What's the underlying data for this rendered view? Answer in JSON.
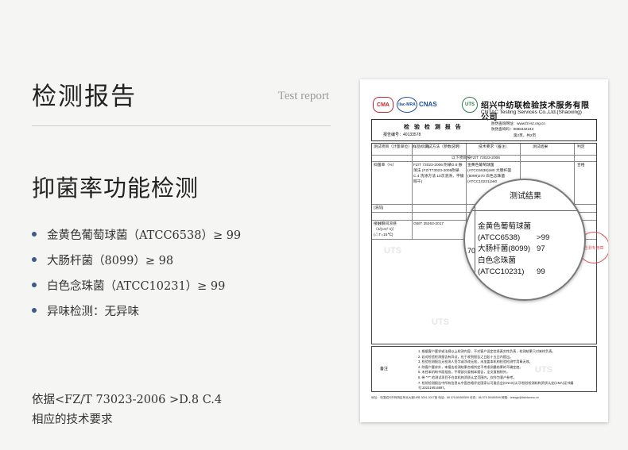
{
  "header": {
    "title": "检测报告",
    "subtitle_en": "Test report"
  },
  "section": {
    "title": "抑菌率功能检测"
  },
  "results": [
    "金黄色葡萄球菌（ATCC6538）≥ 99",
    "大肠杆菌（8099）≥ 98",
    "白色念珠菌（ATCC10231）≥ 99",
    "异味检测：无异味"
  ],
  "basis": {
    "line1": "依据<FZ/T 73023-2006 >D.8 C.4",
    "line2": "相应的技术要求"
  },
  "report": {
    "company_cn": "绍兴中纺联检验技术服务有限公司",
    "company_en": "CNTAC Testing Services Co.,Ltd.(Shaoxing)",
    "doc_title": "检 验 检 测 报 告",
    "report_no_label": "报告编号：",
    "report_no": "40133578",
    "query_site": "防伪查询网址：www.fzi-sz.org.cn",
    "query_code": "防伪查询码：0088432243",
    "page": "第2页，共2页",
    "col_item": "测试项目（计量单位）[样品标识]",
    "col_method": "测试方法（参数说明）",
    "col_req": "技术要求（备注）",
    "col_result": "测试结果",
    "col_judge": "判定",
    "below_blank": "以下项目按FZ/T 73023-2006",
    "row1_item": "抑菌率（%）",
    "row1_method": "FZ/T 73023-2006 附录D.8 振荡法 (FZ/T73023-2006附录C.4 洗涤方法 10次洗涤，平铺晾干)",
    "row1_req": "金黄色葡萄球菌(ATCC6538)≥80 大肠杆菌(8099)≥70 白色念珠菌(ATCC10231)≥60",
    "row1_result_a": ">99",
    "row1_result_b": "97",
    "row1_judge": "合格",
    "row2_item": "[洗前]",
    "row3_item": "接触瞬间凉感（J/(cm²·s)）(△T=15℃)",
    "row3_method": "GB/T 35263-2017",
    "row3_result": "70",
    "notes_label": "备注",
    "notes": [
      "1. 根据客户要求或法规以上检测内容，不对客户设定信息真实性负责，检测结果只对来样负责。",
      "2. 若对检验检测报告有异议，应于收到报告之日起十五日内提出。",
      "3. 检验检测报告无检测人签字或涂改无效，未加盖本机构检验检测专用章无效。",
      "4. 除客户要求外，本报告检测结果合格判定不考虑测量结果的不确定度。",
      "5. 未经本机构书面批准，不得部分复制本报告，全文复制除外。",
      "6. 带 \"**\" 的测试项目不在本机构资质认定范围内，仅作为客户参考。",
      "7. 检验检测报告中所有信息以中国合格评定国家认可委员会(CNAS)认可/检验检测机构资质认定(CMA)证书编号:202319016897。"
    ],
    "footer_line": "地址：中国绍兴市柯桥区柯北大道18号 3001-3017室 电话：86 575 85465599 传真：86 575 85465599 邮箱：testsgs@fabricmmu.cn",
    "magnifier": {
      "header": "测试结果",
      "side_value": "70",
      "rows": [
        {
          "name": "金黄色葡萄球菌",
          "value": ""
        },
        {
          "name": "(ATCC6538)",
          "value": ">99"
        },
        {
          "name": "大肠杆菌(8099)",
          "value": "97"
        },
        {
          "name": "白色念珠菌",
          "value": ""
        },
        {
          "name": "(ATCC10231)",
          "value": "99"
        }
      ]
    },
    "stamp_text": "检测专用章",
    "watermark": "UTS"
  },
  "colors": {
    "bullet": "#3c5a85",
    "stamp": "#d9363e",
    "cma": "#c0262c",
    "cnas": "#1b4e9c"
  }
}
